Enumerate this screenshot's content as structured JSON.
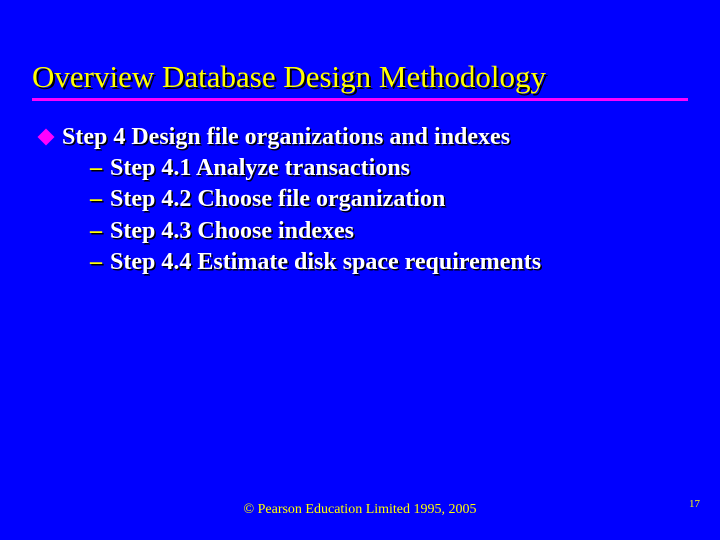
{
  "title": "Overview Database Design Methodology",
  "main": {
    "label": "Step 4  Design file organizations and indexes",
    "subs": [
      "Step 4.1  Analyze transactions",
      "Step 4.2  Choose file organization",
      "Step 4.3  Choose indexes",
      "Step 4.4  Estimate disk space requirements"
    ]
  },
  "footer": "© Pearson Education Limited 1995, 2005",
  "page": "17"
}
